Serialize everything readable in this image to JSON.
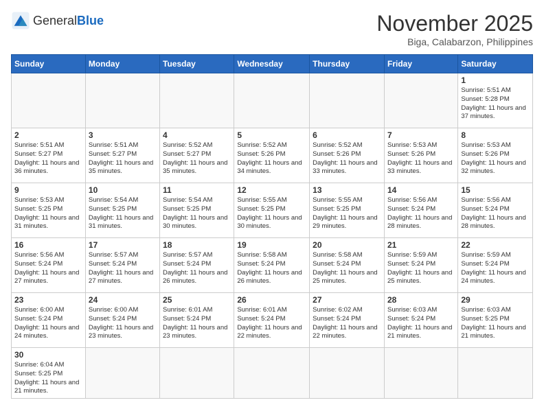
{
  "header": {
    "logo_general": "General",
    "logo_blue": "Blue",
    "month_title": "November 2025",
    "location": "Biga, Calabarzon, Philippines"
  },
  "weekdays": [
    "Sunday",
    "Monday",
    "Tuesday",
    "Wednesday",
    "Thursday",
    "Friday",
    "Saturday"
  ],
  "days": {
    "1": {
      "sunrise": "5:51 AM",
      "sunset": "5:28 PM",
      "daylight": "11 hours and 37 minutes."
    },
    "2": {
      "sunrise": "5:51 AM",
      "sunset": "5:27 PM",
      "daylight": "11 hours and 36 minutes."
    },
    "3": {
      "sunrise": "5:51 AM",
      "sunset": "5:27 PM",
      "daylight": "11 hours and 35 minutes."
    },
    "4": {
      "sunrise": "5:52 AM",
      "sunset": "5:27 PM",
      "daylight": "11 hours and 35 minutes."
    },
    "5": {
      "sunrise": "5:52 AM",
      "sunset": "5:26 PM",
      "daylight": "11 hours and 34 minutes."
    },
    "6": {
      "sunrise": "5:52 AM",
      "sunset": "5:26 PM",
      "daylight": "11 hours and 33 minutes."
    },
    "7": {
      "sunrise": "5:53 AM",
      "sunset": "5:26 PM",
      "daylight": "11 hours and 33 minutes."
    },
    "8": {
      "sunrise": "5:53 AM",
      "sunset": "5:26 PM",
      "daylight": "11 hours and 32 minutes."
    },
    "9": {
      "sunrise": "5:53 AM",
      "sunset": "5:25 PM",
      "daylight": "11 hours and 31 minutes."
    },
    "10": {
      "sunrise": "5:54 AM",
      "sunset": "5:25 PM",
      "daylight": "11 hours and 31 minutes."
    },
    "11": {
      "sunrise": "5:54 AM",
      "sunset": "5:25 PM",
      "daylight": "11 hours and 30 minutes."
    },
    "12": {
      "sunrise": "5:55 AM",
      "sunset": "5:25 PM",
      "daylight": "11 hours and 30 minutes."
    },
    "13": {
      "sunrise": "5:55 AM",
      "sunset": "5:25 PM",
      "daylight": "11 hours and 29 minutes."
    },
    "14": {
      "sunrise": "5:56 AM",
      "sunset": "5:24 PM",
      "daylight": "11 hours and 28 minutes."
    },
    "15": {
      "sunrise": "5:56 AM",
      "sunset": "5:24 PM",
      "daylight": "11 hours and 28 minutes."
    },
    "16": {
      "sunrise": "5:56 AM",
      "sunset": "5:24 PM",
      "daylight": "11 hours and 27 minutes."
    },
    "17": {
      "sunrise": "5:57 AM",
      "sunset": "5:24 PM",
      "daylight": "11 hours and 27 minutes."
    },
    "18": {
      "sunrise": "5:57 AM",
      "sunset": "5:24 PM",
      "daylight": "11 hours and 26 minutes."
    },
    "19": {
      "sunrise": "5:58 AM",
      "sunset": "5:24 PM",
      "daylight": "11 hours and 26 minutes."
    },
    "20": {
      "sunrise": "5:58 AM",
      "sunset": "5:24 PM",
      "daylight": "11 hours and 25 minutes."
    },
    "21": {
      "sunrise": "5:59 AM",
      "sunset": "5:24 PM",
      "daylight": "11 hours and 25 minutes."
    },
    "22": {
      "sunrise": "5:59 AM",
      "sunset": "5:24 PM",
      "daylight": "11 hours and 24 minutes."
    },
    "23": {
      "sunrise": "6:00 AM",
      "sunset": "5:24 PM",
      "daylight": "11 hours and 24 minutes."
    },
    "24": {
      "sunrise": "6:00 AM",
      "sunset": "5:24 PM",
      "daylight": "11 hours and 23 minutes."
    },
    "25": {
      "sunrise": "6:01 AM",
      "sunset": "5:24 PM",
      "daylight": "11 hours and 23 minutes."
    },
    "26": {
      "sunrise": "6:01 AM",
      "sunset": "5:24 PM",
      "daylight": "11 hours and 22 minutes."
    },
    "27": {
      "sunrise": "6:02 AM",
      "sunset": "5:24 PM",
      "daylight": "11 hours and 22 minutes."
    },
    "28": {
      "sunrise": "6:03 AM",
      "sunset": "5:24 PM",
      "daylight": "11 hours and 21 minutes."
    },
    "29": {
      "sunrise": "6:03 AM",
      "sunset": "5:25 PM",
      "daylight": "11 hours and 21 minutes."
    },
    "30": {
      "sunrise": "6:04 AM",
      "sunset": "5:25 PM",
      "daylight": "11 hours and 21 minutes."
    }
  },
  "labels": {
    "sunrise": "Sunrise:",
    "sunset": "Sunset:",
    "daylight": "Daylight:"
  }
}
